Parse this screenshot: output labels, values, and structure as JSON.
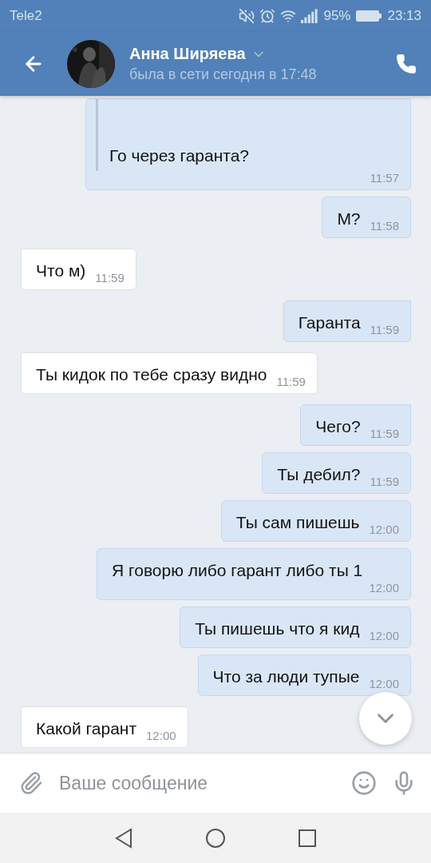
{
  "status_bar": {
    "carrier": "Tele2",
    "battery": "95%",
    "time": "23:13"
  },
  "header": {
    "name": "Анна Ширяева",
    "status": "была в сети сегодня в 17:48"
  },
  "messages": [
    {
      "outgoing": true,
      "reply": true,
      "text": "Го через гаранта?",
      "time": "11:57"
    },
    {
      "outgoing": true,
      "reply": false,
      "text": "М?",
      "time": "11:58"
    },
    {
      "outgoing": false,
      "reply": false,
      "text": "Что м)",
      "time": "11:59"
    },
    {
      "outgoing": true,
      "reply": false,
      "text": "Гаранта",
      "time": "11:59"
    },
    {
      "outgoing": false,
      "reply": false,
      "text": "Ты кидок по тебе сразу видно",
      "time": "11:59"
    },
    {
      "outgoing": true,
      "reply": false,
      "text": "Чего?",
      "time": "11:59"
    },
    {
      "outgoing": true,
      "reply": false,
      "text": "Ты дебил?",
      "time": "11:59"
    },
    {
      "outgoing": true,
      "reply": false,
      "text": "Ты сам пишешь",
      "time": "12:00"
    },
    {
      "outgoing": true,
      "reply": false,
      "text": "Я говорю либо гарант либо ты 1",
      "time": "12:00"
    },
    {
      "outgoing": true,
      "reply": false,
      "text": "Ты пишешь что я кид",
      "time": "12:00"
    },
    {
      "outgoing": true,
      "reply": false,
      "text": "Что за люди тупые",
      "time": "12:00"
    },
    {
      "outgoing": false,
      "reply": false,
      "text": "Какой гарант",
      "time": "12:00"
    }
  ],
  "composer": {
    "placeholder": "Ваше сообщение"
  }
}
